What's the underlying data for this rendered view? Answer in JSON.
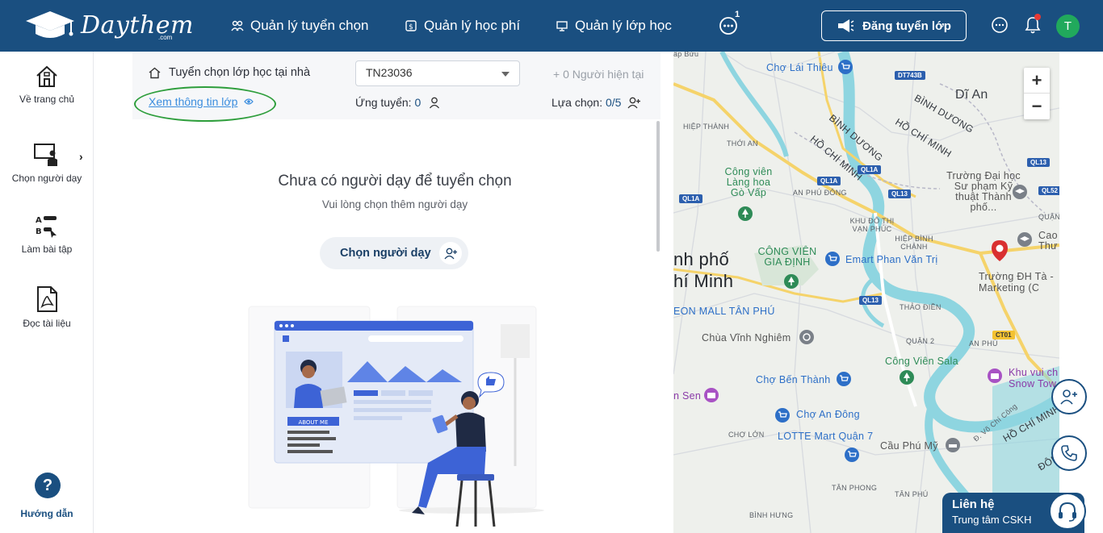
{
  "header": {
    "logo_text": "Daythem",
    "logo_suffix": ".com",
    "nav": [
      {
        "label": "Quản lý tuyển chọn"
      },
      {
        "label": "Quản lý học phí"
      },
      {
        "label": "Quản lý lớp học"
      }
    ],
    "more_badge": "1",
    "post_button": "Đăng tuyển lớp",
    "avatar_initial": "T"
  },
  "sidebar": {
    "items": [
      {
        "label": "Về trang chủ"
      },
      {
        "label": "Chọn người dạy"
      },
      {
        "label": "Làm bài tập"
      },
      {
        "label": "Đọc tài liệu"
      }
    ],
    "help_symbol": "?",
    "help_label": "Hướng dẫn"
  },
  "class_info": {
    "title": "Tuyển chọn lớp học tại nhà",
    "view_link": "Xem thông tin lớp",
    "class_code": "TN23036",
    "current_text": "+ 0 Người hiện tại",
    "apply_label": "Ứng tuyển:",
    "apply_value": "0",
    "select_label": "Lựa chọn:",
    "select_value": "0/5"
  },
  "empty_state": {
    "title": "Chưa có người dạy để tuyển chọn",
    "subtitle": "Vui lòng chọn thêm người dạy",
    "button": "Chọn người dạy",
    "illustration_text": "ABOUT ME"
  },
  "map": {
    "zoom_in": "+",
    "zoom_out": "−",
    "labels": {
      "ap_buu": "ấp Bửu",
      "cho_lai_thieu": "Chợ Lái Thiêu",
      "di_an": "Dĩ An",
      "binh_duong_1": "BÌNH DƯƠNG",
      "binh_duong_2": "BÌNH DƯƠNG",
      "hcm_1": "HỒ CHÍ MINH",
      "hcm_2": "HỒ CHÍ MINH",
      "hcm_3": "HỒ CHÍ MINH",
      "hiep_thanh": "HIỆP THÀNH",
      "thoi_an": "THỚI AN",
      "cong_vien_lang_hoa": "Công viên Làng hoa Gò Vấp",
      "an_phu_dong": "AN PHÚ ĐÔNG",
      "khu_do_thi": "KHU ĐÔ THỊ VẠN PHÚC",
      "hiep_binh": "HIỆP BÌNH CHÁNH",
      "truong_dai_hoc": "Trường Đại học Sư phạm Kỹ thuật Thành phố...",
      "quan": "QUẬN",
      "cao_thu": "Cao Thư",
      "city_1": "nh phố",
      "city_2": "hí Minh",
      "cong_vien_gia_dinh": "CÔNG VIÊN GIA ĐỊNH",
      "emart": "Emart Phan Văn Trị",
      "truong_marketing": "Trường ĐH Tà - Marketing (C",
      "aeon": "EON MALL TÂN PHÚ",
      "thao_dien": "THẢO ĐIỀN",
      "chua_vinh_nghiem": "Chùa Vĩnh Nghiêm",
      "quan_2": "QUẬN 2",
      "an_phu": "AN PHÚ",
      "cong_vien_sala": "Công Viên Sala",
      "cho_ben_thanh": "Chợ Bến Thành",
      "khu_vui_choi": "Khu vui ch Snow Tow",
      "sen": "n Sen",
      "cho_an_dong": "Chợ An Đông",
      "cho_lon": "CHỢ LỚN",
      "lotte": "LOTTE Mart Quận 7",
      "cau_phu_my": "Cầu Phú Mỹ",
      "hcm_4": "HỒ CHÍ MINH",
      "dong": "ĐÔNG",
      "vo_chi_cong": "Đ. Võ Chí Công",
      "tan_phong_1": "TÂN PHONG",
      "tan_phong_2": "TÂN PHÚ",
      "binh_hung": "BÌNH HƯNG"
    },
    "shields": [
      "DT743B",
      "QL1A",
      "QL13",
      "QL1A",
      "QL1A",
      "QL52",
      "QL13",
      "CT01",
      "QL13"
    ]
  },
  "contact": {
    "title": "Liên hệ",
    "subtitle": "Trung tâm CSKH"
  },
  "colors": {
    "primary": "#1a4f80",
    "accent_link": "#3a8dde",
    "annotation_oval": "#2e9e3c",
    "avatar": "#21a95c"
  }
}
